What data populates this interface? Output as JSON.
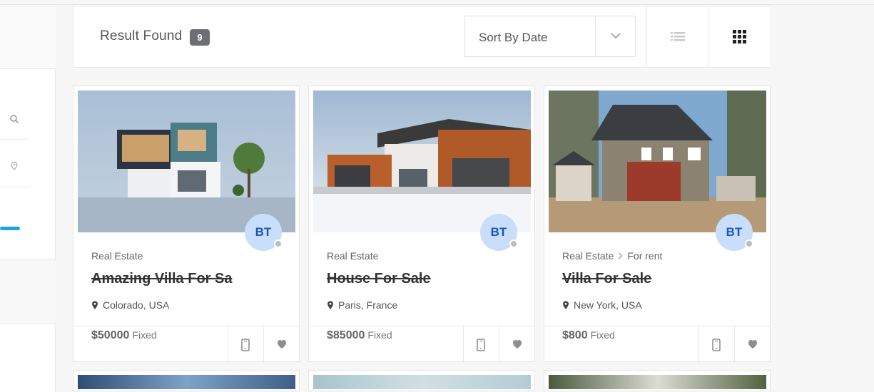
{
  "results": {
    "label": "Result Found",
    "count": "9"
  },
  "sort": {
    "selected": "Sort By Date"
  },
  "view_modes": [
    "list-icon",
    "grid-icon"
  ],
  "listings": [
    {
      "category": "Real Estate",
      "subcategory": "",
      "title": "Amazing Villa For Sa",
      "location": "Colorado, USA",
      "price": "$50000",
      "price_type": "Fixed",
      "agent_initials": "BT"
    },
    {
      "category": "Real Estate",
      "subcategory": "",
      "title": "House For Sale",
      "location": "Paris, France",
      "price": "$85000",
      "price_type": "Fixed",
      "agent_initials": "BT"
    },
    {
      "category": "Real Estate",
      "subcategory": "For rent",
      "title": "Villa For Sale",
      "location": "New York, USA",
      "price": "$800",
      "price_type": "Fixed",
      "agent_initials": "BT"
    }
  ],
  "colors": {
    "accent": "#1aa3e8",
    "avatar_bg": "#c9defa",
    "avatar_text": "#1656c2",
    "badge_bg": "#6b6f75"
  }
}
